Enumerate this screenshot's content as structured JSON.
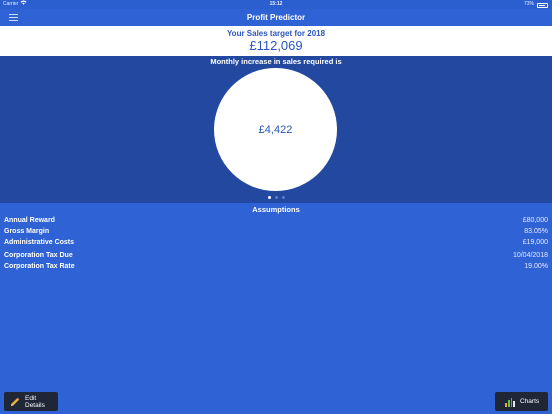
{
  "status_bar": {
    "carrier": "Carrier",
    "time": "15:12",
    "battery": "73%"
  },
  "nav": {
    "title": "Profit Predictor"
  },
  "target": {
    "label": "Your Sales target for 2018",
    "value": "£112,069"
  },
  "increase": {
    "label": "Monthly increase in sales required is",
    "value": "£4,422",
    "page_count": 3,
    "active_page": 1
  },
  "assumptions": {
    "title": "Assumptions",
    "rows": [
      {
        "label": "Annual Reward",
        "value": "£80,000"
      },
      {
        "label": "Gross Margin",
        "value": "83.05%"
      },
      {
        "label": "Administrative Costs",
        "value": "£19,000"
      },
      {
        "label": "Corporation Tax Due",
        "value": "10/04/2018"
      },
      {
        "label": "Corporation Tax Rate",
        "value": "19.00%"
      }
    ]
  },
  "buttons": {
    "edit_label": "Edit Details",
    "charts_label": "Charts"
  },
  "icons": {
    "menu": "hamburger-menu-icon",
    "edit": "pencil-icon",
    "charts": "bar-chart-icon",
    "wifi": "wifi-icon",
    "battery": "battery-icon"
  },
  "colors": {
    "background": "#2f62d4",
    "circle_panel": "#2348a0",
    "accent_text": "#2b56c0",
    "button": "#1f2636"
  }
}
